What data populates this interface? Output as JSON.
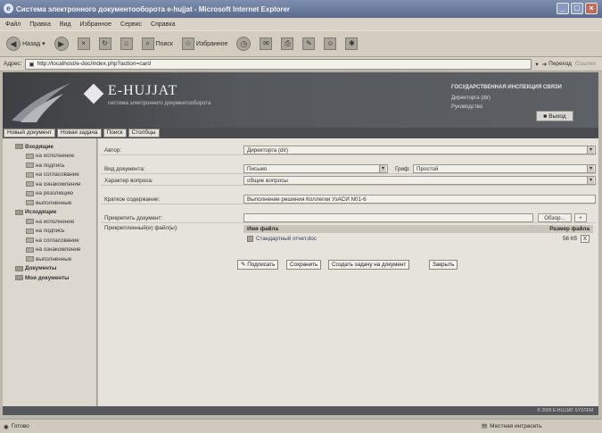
{
  "window": {
    "title": "Система электронного документооборота e-hujjat - Microsoft Internet Explorer",
    "buttons": [
      "_",
      "□",
      "×"
    ]
  },
  "menu": [
    "Файл",
    "Правка",
    "Вид",
    "Избранное",
    "Сервис",
    "Справка"
  ],
  "toolbar": {
    "back": "Назад",
    "search": "Поиск",
    "favorites": "Избранное"
  },
  "address": {
    "label": "Адрес:",
    "url": "http://localhost/e-doc/index.php?action=card",
    "go": "Переход",
    "links": "Ссылки"
  },
  "banner": {
    "logo_title": "E-HUJJAT",
    "logo_subtitle": "система электронного документооборота",
    "org": "ГОСУДАРСТВЕННАЯ ИНСПЕКЦИЯ СВЯЗИ",
    "user_line1": "Директорга (dir)",
    "user_line2": "Руководство",
    "logout": "Выход"
  },
  "tabs": [
    "Новый документ",
    "Новая задача",
    "Поиск",
    "Столбцы"
  ],
  "sidebar": {
    "groups": [
      {
        "title": "Входящие",
        "items": [
          "на исполнение",
          "на подпись",
          "на согласование",
          "на ознакомление",
          "на резолюцию",
          "выполненные"
        ]
      },
      {
        "title": "Исходящие",
        "items": [
          "на исполнение",
          "на подпись",
          "на согласование",
          "на ознакомление",
          "выполненные"
        ]
      },
      {
        "title": "Документы",
        "items": []
      },
      {
        "title": "Мои документы",
        "items": []
      }
    ]
  },
  "form": {
    "author_label": "Автор:",
    "author_value": "Директорга (dir)",
    "doctype_label": "Вид документа:",
    "doctype_value": "Письмо",
    "grif_label": "Гриф:",
    "grif_value": "Простой",
    "question_label": "Характер вопроса:",
    "question_value": "общие вопросы",
    "summary_label": "Краткое содержание:",
    "summary_value": "Выполнение решения Коллегии УзАСИ N01-6",
    "attach_label": "Прикрепить документ:",
    "browse": "Обзор...",
    "plus": "+",
    "attached_label": "Прикрепленный(е) файл(ы):",
    "file_name_header": "Имя файла",
    "file_size_header": "Размер файла",
    "file_name": "Стандартный отчет.doc",
    "file_size": "56 Кб",
    "file_remove": "X"
  },
  "buttons": {
    "sign": "Подписать",
    "save": "Сохранить",
    "create_task": "Создать задачу на документ",
    "close": "Закрыть"
  },
  "footer": {
    "copyright": "© 2005 E-HUJJAT SYSTEM"
  },
  "status": {
    "left": "Готово",
    "zone": "Местная интрасеть"
  }
}
